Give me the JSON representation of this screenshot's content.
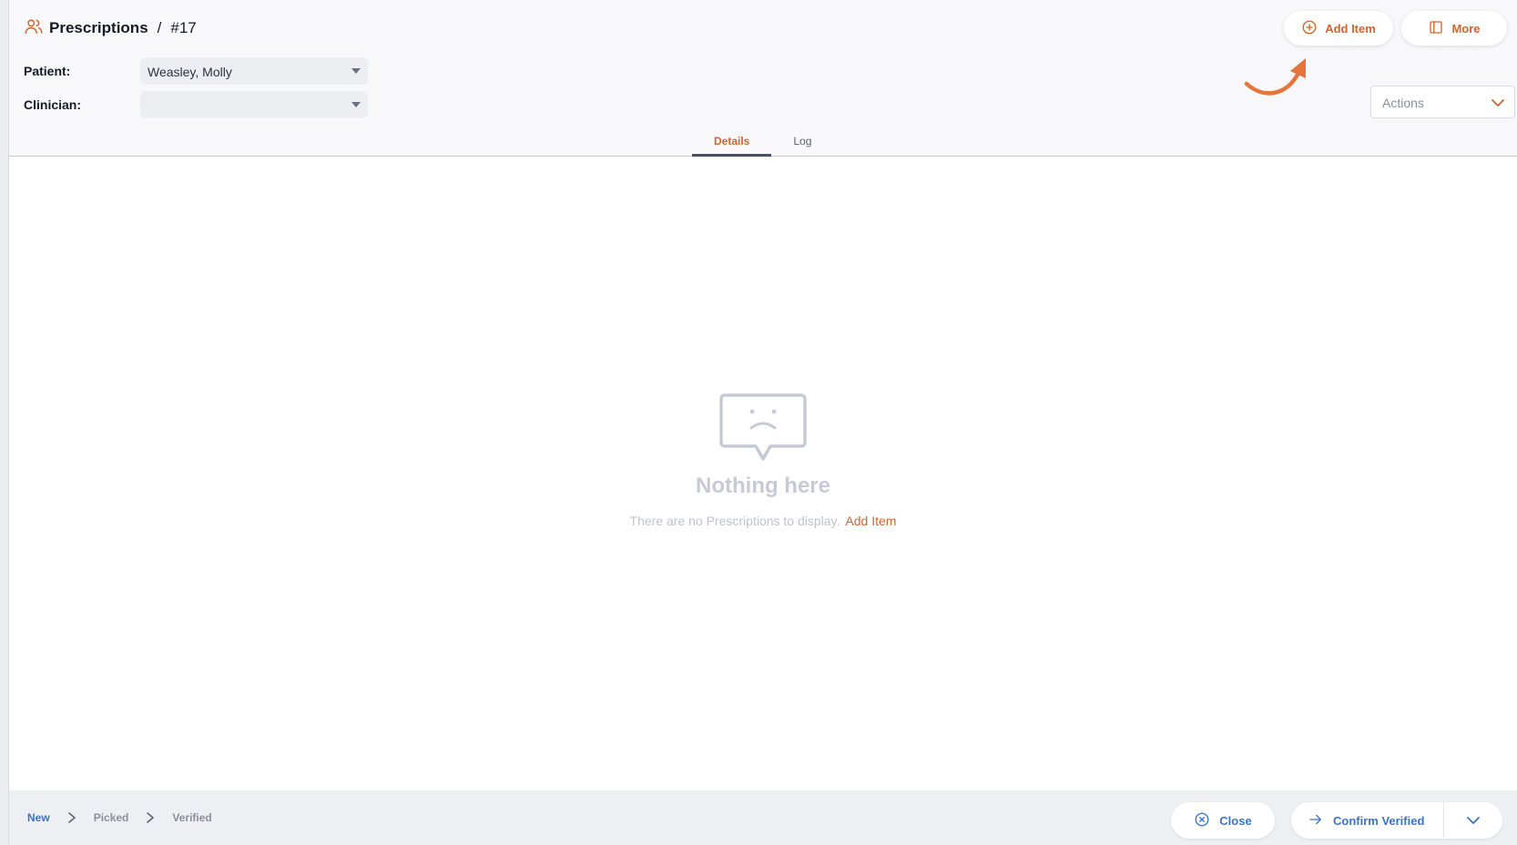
{
  "header": {
    "module_title": "Prescriptions",
    "separator": "/",
    "record_id": "#17",
    "module_icon": "users-icon"
  },
  "fields": {
    "patient_label": "Patient:",
    "patient_value": "Weasley, Molly",
    "clinician_label": "Clinician:",
    "clinician_value": ""
  },
  "toolbar": {
    "add_item_label": "Add Item",
    "more_label": "More",
    "actions_placeholder": "Actions"
  },
  "tabs": [
    {
      "label": "Details",
      "active": true
    },
    {
      "label": "Log",
      "active": false
    }
  ],
  "empty_state": {
    "title": "Nothing here",
    "message": "There are no Prescriptions to display.",
    "link_label": "Add Item"
  },
  "footer": {
    "steps": [
      {
        "label": "New",
        "current": true
      },
      {
        "label": "Picked",
        "current": false
      },
      {
        "label": "Verified",
        "current": false
      }
    ],
    "close_label": "Close",
    "confirm_label": "Confirm Verified"
  },
  "colors": {
    "accent": "#d0642f",
    "link_blue": "#3b73c5",
    "muted": "#c7cad6"
  }
}
